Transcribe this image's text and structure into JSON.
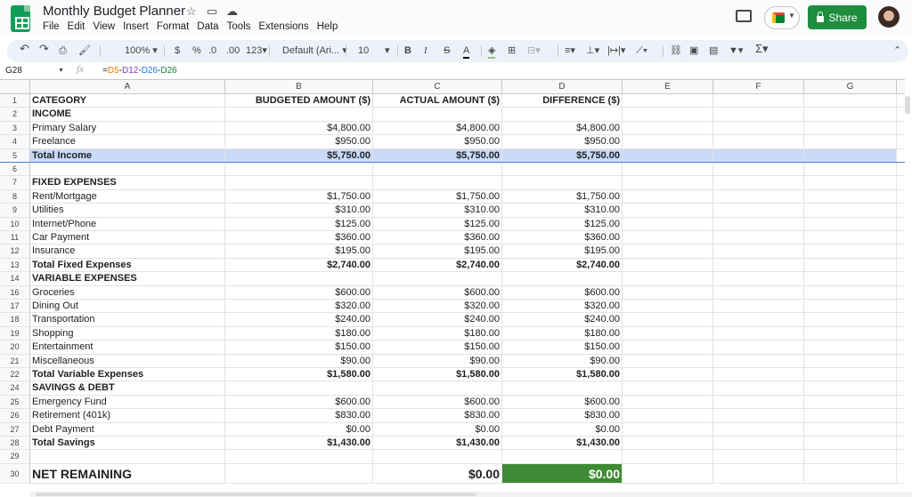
{
  "app": {
    "title": "Monthly Budget Planner",
    "menu": [
      "File",
      "Edit",
      "View",
      "Insert",
      "Format",
      "Data",
      "Tools",
      "Extensions",
      "Help"
    ],
    "share_label": "Share",
    "accent": "#1e8e3e"
  },
  "toolbar": {
    "zoom": "100%",
    "currency": "$",
    "percent": "%",
    "dec_decrease": ".0",
    "dec_increase": ".00",
    "more_formats": "123",
    "font": "Default (Ari...",
    "font_size": "10",
    "bold": "B",
    "italic": "I",
    "strike": "S",
    "text_color": "A",
    "functions": "Σ"
  },
  "formula_bar": {
    "cell_ref": "G28",
    "fx": "fx",
    "formula_eq": "=",
    "ref1": "D5",
    "op1": "-",
    "ref2": "D12",
    "op2": "-",
    "ref3": "D26",
    "op3": "-",
    "ref4": "D26"
  },
  "columns": [
    "A",
    "B",
    "C",
    "D",
    "E",
    "F",
    "G"
  ],
  "rows": [
    {
      "n": "1",
      "a": "CATEGORY",
      "b": "BUDGETED AMOUNT ($)",
      "c": "ACTUAL AMOUNT ($)",
      "d": "DIFFERENCE ($)",
      "style": "header"
    },
    {
      "n": "2",
      "a": "INCOME",
      "b": "",
      "c": "",
      "d": "",
      "style": "section"
    },
    {
      "n": "3",
      "a": "Primary Salary",
      "b": "$4,800.00",
      "c": "$4,800.00",
      "d": "$4,800.00",
      "style": ""
    },
    {
      "n": "4",
      "a": "Freelance",
      "b": "$950.00",
      "c": "$950.00",
      "d": "$950.00",
      "style": ""
    },
    {
      "n": "5",
      "a": "Total Income",
      "b": "$5,750.00",
      "c": "$5,750.00",
      "d": "$5,750.00",
      "style": "total-hi"
    },
    {
      "n": "6",
      "a": "",
      "b": "",
      "c": "",
      "d": "",
      "style": ""
    },
    {
      "n": "7",
      "a": "FIXED EXPENSES",
      "b": "",
      "c": "",
      "d": "",
      "style": "section"
    },
    {
      "n": "8",
      "a": "Rent/Mortgage",
      "b": "$1,750.00",
      "c": "$1,750.00",
      "d": "$1,750.00",
      "style": ""
    },
    {
      "n": "9",
      "a": "Utilities",
      "b": "$310.00",
      "c": "$310.00",
      "d": "$310.00",
      "style": ""
    },
    {
      "n": "10",
      "a": "Internet/Phone",
      "b": "$125.00",
      "c": "$125.00",
      "d": "$125.00",
      "style": ""
    },
    {
      "n": "11",
      "a": "Car Payment",
      "b": "$360.00",
      "c": "$360.00",
      "d": "$360.00",
      "style": ""
    },
    {
      "n": "12",
      "a": "Insurance",
      "b": "$195.00",
      "c": "$195.00",
      "d": "$195.00",
      "style": ""
    },
    {
      "n": "13",
      "a": "Total Fixed Expenses",
      "b": "$2,740.00",
      "c": "$2,740.00",
      "d": "$2,740.00",
      "style": "total"
    },
    {
      "n": "14",
      "a": "VARIABLE EXPENSES",
      "b": "",
      "c": "",
      "d": "",
      "style": "section"
    },
    {
      "n": "16",
      "a": "Groceries",
      "b": "$600.00",
      "c": "$600.00",
      "d": "$600.00",
      "style": ""
    },
    {
      "n": "17",
      "a": "Dining Out",
      "b": "$320.00",
      "c": "$320.00",
      "d": "$320.00",
      "style": ""
    },
    {
      "n": "18",
      "a": "Transportation",
      "b": "$240.00",
      "c": "$240.00",
      "d": "$240.00",
      "style": ""
    },
    {
      "n": "19",
      "a": "Shopping",
      "b": "$180.00",
      "c": "$180.00",
      "d": "$180.00",
      "style": ""
    },
    {
      "n": "20",
      "a": "Entertainment",
      "b": "$150.00",
      "c": "$150.00",
      "d": "$150.00",
      "style": ""
    },
    {
      "n": "21",
      "a": "Miscellaneous",
      "b": "$90.00",
      "c": "$90.00",
      "d": "$90.00",
      "style": ""
    },
    {
      "n": "22",
      "a": "Total Variable Expenses",
      "b": "$1,580.00",
      "c": "$1,580.00",
      "d": "$1,580.00",
      "style": "total"
    },
    {
      "n": "24",
      "a": "SAVINGS & DEBT",
      "b": "",
      "c": "",
      "d": "",
      "style": "section"
    },
    {
      "n": "25",
      "a": "Emergency Fund",
      "b": "$600.00",
      "c": "$600.00",
      "d": "$600.00",
      "style": ""
    },
    {
      "n": "26",
      "a": "Retirement (401k)",
      "b": "$830.00",
      "c": "$830.00",
      "d": "$830.00",
      "style": ""
    },
    {
      "n": "27",
      "a": "Debt Payment",
      "b": "$0.00",
      "c": "$0.00",
      "d": "$0.00",
      "style": ""
    },
    {
      "n": "28",
      "a": "Total Savings",
      "b": "$1,430.00",
      "c": "$1,430.00",
      "d": "$1,430.00",
      "style": "total"
    },
    {
      "n": "29",
      "a": "",
      "b": "",
      "c": "",
      "d": "",
      "style": ""
    }
  ],
  "net_row": {
    "n": "30",
    "a": "NET REMAINING",
    "b": "",
    "c": "$0.00",
    "d": "$0.00"
  },
  "colors": {
    "highlight": "#c9daf8",
    "net_green": "#3f8a34"
  }
}
